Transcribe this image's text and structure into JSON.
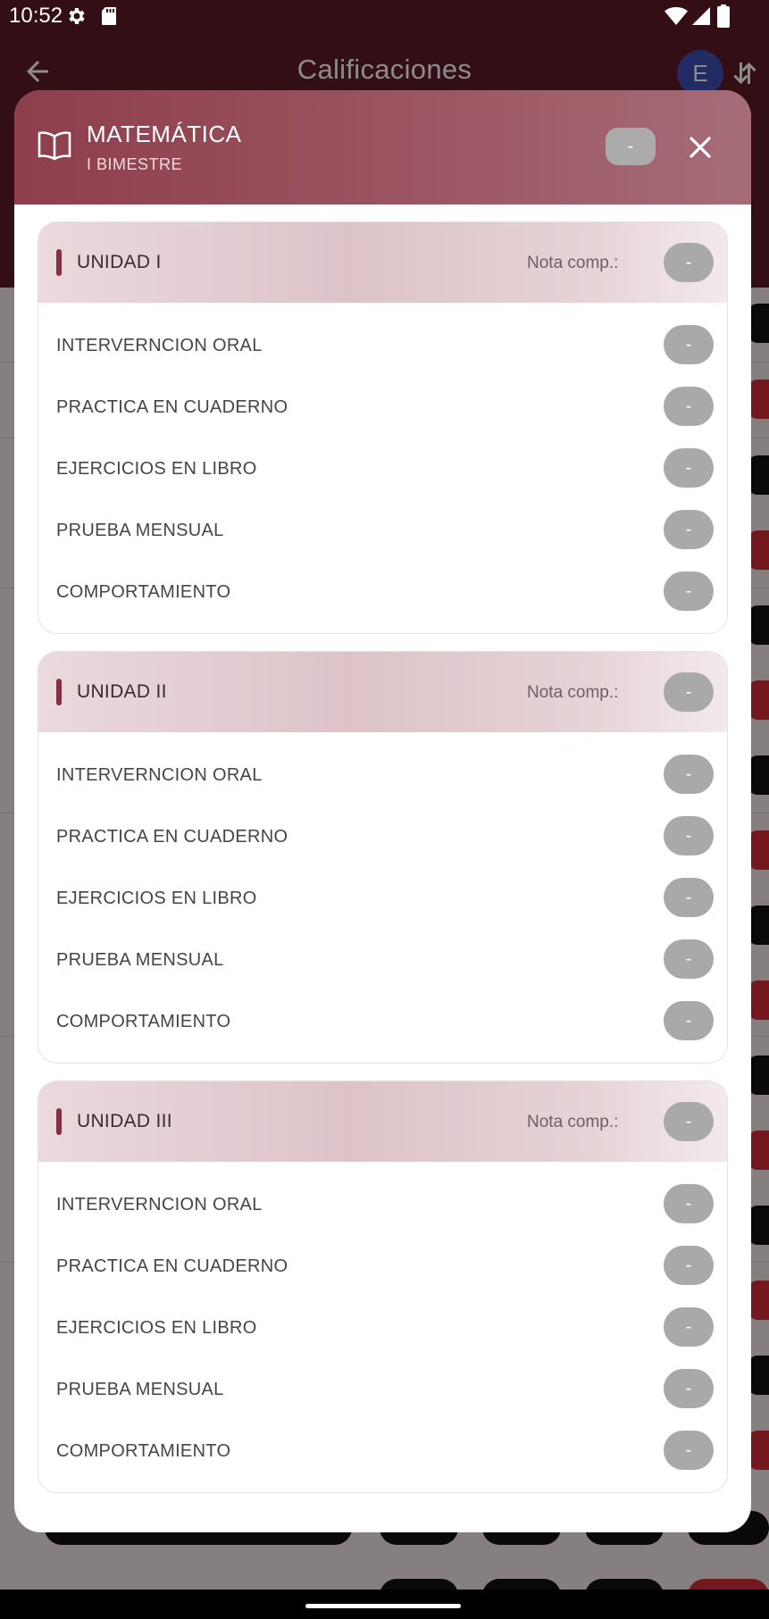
{
  "status_bar": {
    "time": "10:52"
  },
  "app": {
    "title": "Calificaciones",
    "avatar_initial": "E"
  },
  "modal": {
    "subject": "MATEMÁTICA",
    "period": "I BIMESTRE",
    "header_grade": "-",
    "units": [
      {
        "title": "UNIDAD I",
        "nota_label": "Nota comp.:",
        "grade": "-",
        "evaluations": [
          {
            "label": "INTERVERNCION ORAL",
            "grade": "-"
          },
          {
            "label": "PRACTICA EN CUADERNO",
            "grade": "-"
          },
          {
            "label": "EJERCICIOS EN LIBRO",
            "grade": "-"
          },
          {
            "label": "PRUEBA MENSUAL",
            "grade": "-"
          },
          {
            "label": "COMPORTAMIENTO",
            "grade": "-"
          }
        ]
      },
      {
        "title": "UNIDAD II",
        "nota_label": "Nota comp.:",
        "grade": "-",
        "evaluations": [
          {
            "label": "INTERVERNCION ORAL",
            "grade": "-"
          },
          {
            "label": "PRACTICA EN CUADERNO",
            "grade": "-"
          },
          {
            "label": "EJERCICIOS EN LIBRO",
            "grade": "-"
          },
          {
            "label": "PRUEBA MENSUAL",
            "grade": "-"
          },
          {
            "label": "COMPORTAMIENTO",
            "grade": "-"
          }
        ]
      },
      {
        "title": "UNIDAD III",
        "nota_label": "Nota comp.:",
        "grade": "-",
        "evaluations": [
          {
            "label": "INTERVERNCION ORAL",
            "grade": "-"
          },
          {
            "label": "PRACTICA EN CUADERNO",
            "grade": "-"
          },
          {
            "label": "EJERCICIOS EN LIBRO",
            "grade": "-"
          },
          {
            "label": "PRUEBA MENSUAL",
            "grade": "-"
          },
          {
            "label": "COMPORTAMIENTO",
            "grade": "-"
          }
        ]
      }
    ]
  },
  "colors": {
    "brand": "#8e3e4c",
    "accent": "#8a2d3d",
    "grade_pill": "#a9a9a9"
  },
  "icons": [
    "back-icon",
    "sort-icon",
    "book-icon",
    "close-icon",
    "gear-icon",
    "sd-card-icon",
    "wifi-icon",
    "signal-icon",
    "battery-icon"
  ]
}
